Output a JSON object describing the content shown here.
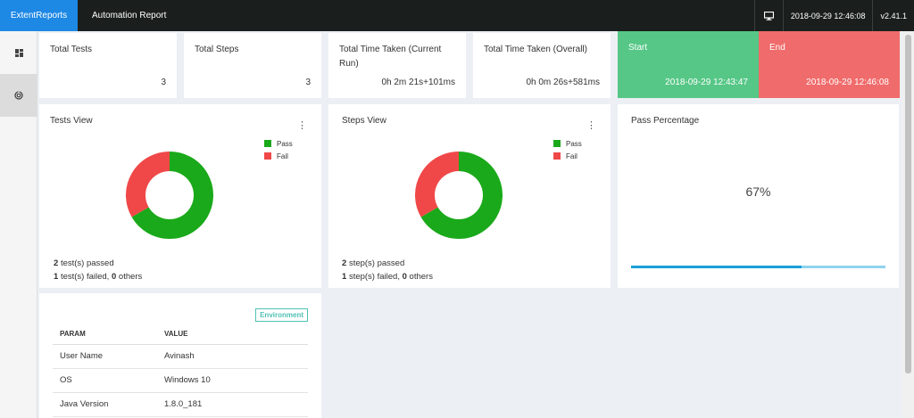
{
  "header": {
    "brand": "ExtentReports",
    "title": "Automation Report",
    "datetime": "2018-09-29 12:46:08",
    "version": "v2.41.1"
  },
  "sidebar": {
    "items": [
      {
        "icon": "dashboard-icon"
      },
      {
        "icon": "analytics-icon"
      }
    ]
  },
  "stats": {
    "total_tests": {
      "label": "Total Tests",
      "value": "3"
    },
    "total_steps": {
      "label": "Total Steps",
      "value": "3"
    },
    "time_current": {
      "label": "Total Time Taken (Current Run)",
      "value": "0h 2m 21s+101ms"
    },
    "time_overall": {
      "label": "Total Time Taken (Overall)",
      "value": "0h 0m 26s+581ms"
    },
    "start": {
      "label": "Start",
      "value": "2018-09-29 12:43:47"
    },
    "end": {
      "label": "End",
      "value": "2018-09-29 12:46:08"
    }
  },
  "tests_view": {
    "title": "Tests View",
    "legend": [
      {
        "name": "Pass",
        "color": "#1aa91a"
      },
      {
        "name": "Fail",
        "color": "#f04848"
      }
    ],
    "passed_count": "2",
    "passed_text": "test(s) passed",
    "failed_count": "1",
    "failed_text": "test(s) failed,",
    "others_count": "0",
    "others_text": "others"
  },
  "steps_view": {
    "title": "Steps View",
    "legend": [
      {
        "name": "Pass",
        "color": "#1aa91a"
      },
      {
        "name": "Fail",
        "color": "#f04848"
      }
    ],
    "passed_count": "2",
    "passed_text": "step(s) passed",
    "failed_count": "1",
    "failed_text": "step(s) failed,",
    "others_count": "0",
    "others_text": "others"
  },
  "pass_percentage": {
    "title": "Pass Percentage",
    "value_text": "67%",
    "value": 67
  },
  "environment": {
    "badge": "Environment",
    "headers": {
      "param": "PARAM",
      "value": "VALUE"
    },
    "rows": [
      {
        "param": "User Name",
        "value": "Avinash"
      },
      {
        "param": "OS",
        "value": "Windows 10"
      },
      {
        "param": "Java Version",
        "value": "1.8.0_181"
      }
    ]
  },
  "chart_data": [
    {
      "type": "pie",
      "categories": [
        "Pass",
        "Fail"
      ],
      "values": [
        2,
        1
      ],
      "title": "Tests View",
      "colors": [
        "#1aa91a",
        "#f04848"
      ]
    },
    {
      "type": "pie",
      "categories": [
        "Pass",
        "Fail"
      ],
      "values": [
        2,
        1
      ],
      "title": "Steps View",
      "colors": [
        "#1aa91a",
        "#f04848"
      ]
    }
  ]
}
